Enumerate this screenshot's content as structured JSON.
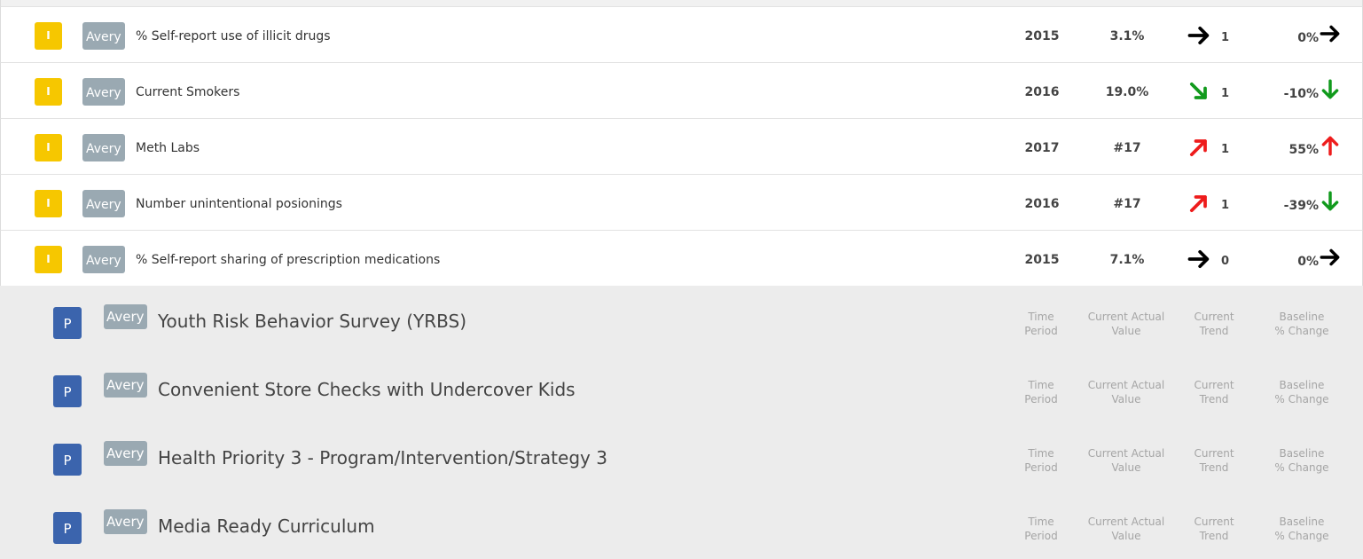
{
  "indicators": [
    {
      "badge": "I",
      "owner": "Avery",
      "title": "% Self-report use of illicit drugs",
      "period": "2015",
      "value": "3.1%",
      "trend_dir": "right",
      "trend_count": "1",
      "baseline_change": "0%",
      "change_dir": "right",
      "trend_color": "#000000",
      "change_color": "#000000"
    },
    {
      "badge": "I",
      "owner": "Avery",
      "title": "Current Smokers",
      "period": "2016",
      "value": "19.0%",
      "trend_dir": "down-right",
      "trend_count": "1",
      "baseline_change": "-10%",
      "change_dir": "down",
      "trend_color": "#119a1c",
      "change_color": "#119a1c"
    },
    {
      "badge": "I",
      "owner": "Avery",
      "title": "Meth Labs",
      "period": "2017",
      "value": "#17",
      "trend_dir": "up-right",
      "trend_count": "1",
      "baseline_change": "55%",
      "change_dir": "up",
      "trend_color": "#ee1c1c",
      "change_color": "#ee1c1c"
    },
    {
      "badge": "I",
      "owner": "Avery",
      "title": "Number unintentional posionings",
      "period": "2016",
      "value": "#17",
      "trend_dir": "up-right",
      "trend_count": "1",
      "baseline_change": "-39%",
      "change_dir": "down",
      "trend_color": "#ee1c1c",
      "change_color": "#119a1c"
    },
    {
      "badge": "I",
      "owner": "Avery",
      "title": "% Self-report sharing of prescription medications",
      "period": "2015",
      "value": "7.1%",
      "trend_dir": "right",
      "trend_count": "0",
      "baseline_change": "0%",
      "change_dir": "right",
      "trend_color": "#000000",
      "change_color": "#000000"
    }
  ],
  "program_header": {
    "period": [
      "Time",
      "Period"
    ],
    "value": [
      "Current Actual",
      "Value"
    ],
    "trend": [
      "Current",
      "Trend"
    ],
    "baseline": [
      "Baseline",
      "% Change"
    ]
  },
  "programs": [
    {
      "badge": "P",
      "owner": "Avery",
      "title": "Youth Risk Behavior Survey (YRBS)"
    },
    {
      "badge": "P",
      "owner": "Avery",
      "title": "Convenient Store Checks with Undercover Kids"
    },
    {
      "badge": "P",
      "owner": "Avery",
      "title": "Health Priority 3 - Program/Intervention/Strategy 3"
    },
    {
      "badge": "P",
      "owner": "Avery",
      "title": "Media Ready Curriculum"
    }
  ],
  "colors": {
    "indicator_badge": "#f6c700",
    "program_badge": "#3b64ad",
    "owner_tag": "#9aa9b2"
  }
}
